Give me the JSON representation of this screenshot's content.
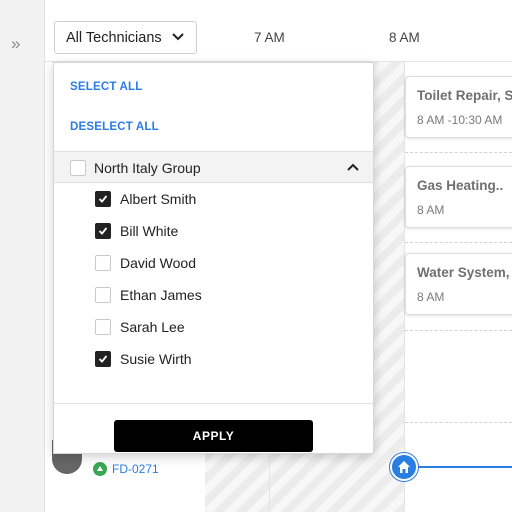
{
  "header": {
    "filter_label": "All Technicians",
    "filter_caret_icon": "chevron-down-icon",
    "rail_toggle": "»",
    "time_labels": [
      "7 AM",
      "8 AM"
    ]
  },
  "jobs": [
    {
      "title": "Toilet Repair, S",
      "time": "8 AM -10:30 AM"
    },
    {
      "title": "Gas Heating..",
      "time": "8 AM"
    },
    {
      "title": "Water System, I",
      "time": "8 AM"
    }
  ],
  "technician_row": {
    "id": "FD-0271",
    "status_icon": "arrow-up-icon",
    "status_color": "#3aa655",
    "pin_icon": "home-icon"
  },
  "dropdown": {
    "select_all": "SELECT ALL",
    "deselect_all": "DESELECT ALL",
    "group": {
      "label": "North Italy Group",
      "checked": false,
      "expanded": true
    },
    "items": [
      {
        "label": "Albert Smith",
        "checked": true
      },
      {
        "label": "Bill White",
        "checked": true
      },
      {
        "label": "David Wood",
        "checked": false
      },
      {
        "label": "Ethan James",
        "checked": false
      },
      {
        "label": "Sarah Lee",
        "checked": false
      },
      {
        "label": "Susie Wirth",
        "checked": true
      }
    ],
    "apply_label": "APPLY"
  },
  "colors": {
    "accent": "#2a7de1",
    "button_bg": "#000000",
    "checkbox_checked": "#222222"
  }
}
